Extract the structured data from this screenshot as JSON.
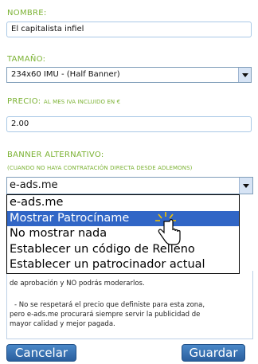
{
  "form": {
    "nombre_label": "NOMBRE:",
    "nombre_value": "El capitalista infiel",
    "tamano_label": "TAMAÑO:",
    "tamano_value": "234x60 IMU - (Half Banner)",
    "precio_label": "PRECIO:",
    "precio_hint": "AL MES IVA INCLUIDO EN €",
    "precio_value": "2.00",
    "banner_label": "BANNER ALTERNATIVO:",
    "banner_hint": "(CUANDO NO HAYA CONTRATACIÓN DIRECTA DESDE ADLEMONS)",
    "banner_value": "e-ads.me"
  },
  "dropdown": {
    "options": [
      "e-ads.me",
      "Mostrar Patrocíname",
      "No mostrar nada",
      "Establecer un código de Relleno",
      "Establecer un patrocinador actual"
    ],
    "selected_index": 1
  },
  "notes": {
    "line1": "de aprobación y NO podrás moderarlos.",
    "line2": "- No se respetará el precio que definiste para esta zona,",
    "line3": "pero e-ads.me procurará siempre servir la publicidad de",
    "line4": "mayor calidad y mejor pagada."
  },
  "buttons": {
    "cancel": "Cancelar",
    "save": "Guardar"
  },
  "colors": {
    "label_green": "#7bb233",
    "selected_blue": "#3166c6",
    "button_blue": "#2a5f9e"
  }
}
